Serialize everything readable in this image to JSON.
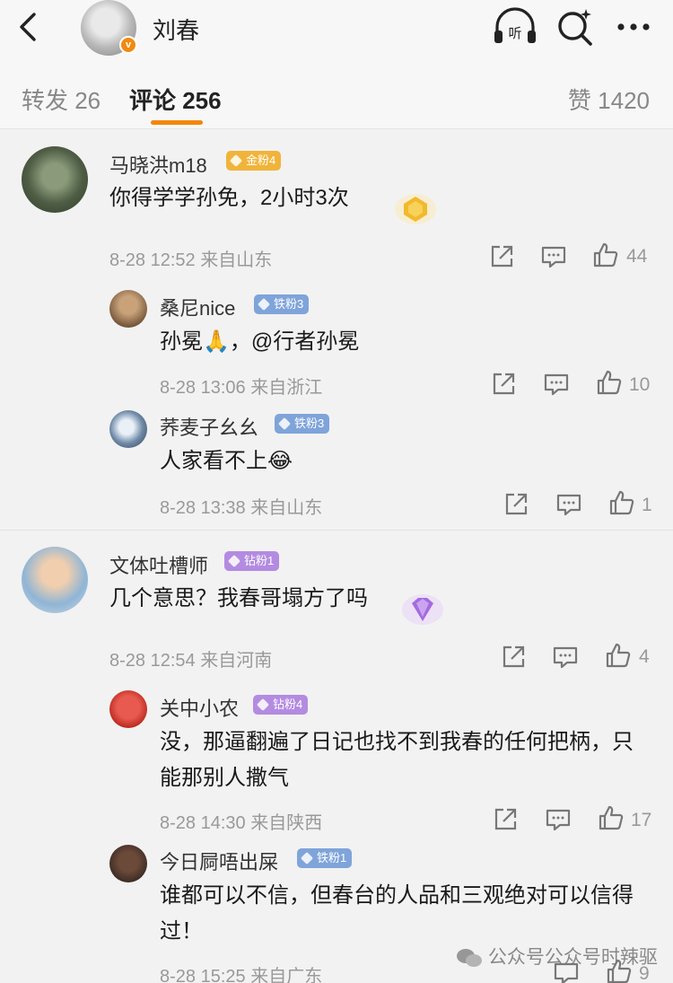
{
  "header": {
    "title": "刘春",
    "verified_mark": "v"
  },
  "tabs": [
    {
      "label": "转发 26"
    },
    {
      "label": "评论 256"
    },
    {
      "label": "赞 1420"
    }
  ],
  "comments": [
    {
      "user": "马晓洪m18",
      "badge": "金粉4",
      "text": "你得学学孙免，2小时3次",
      "meta": "8-28 12:52  来自山东",
      "likes": "44",
      "replies": [
        {
          "user": "桑尼nice",
          "badge": "铁粉3",
          "text": "孙冕🙏，@行者孙冕",
          "meta": "8-28 13:06  来自浙江",
          "likes": "10"
        },
        {
          "user": "荞麦子幺幺",
          "badge": "铁粉3",
          "text": "人家看不上😂",
          "meta": "8-28 13:38  来自山东",
          "likes": "1"
        }
      ]
    },
    {
      "user": "文体吐槽师",
      "badge": "钻粉1",
      "text": "几个意思？我春哥塌方了吗",
      "meta": "8-28 12:54  来自河南",
      "likes": "4",
      "replies": [
        {
          "user": "关中小农",
          "badge": "钻粉4",
          "text": "没，那逼翻遍了日记也找不到我春的任何把柄，只能那别人撒气",
          "meta": "8-28 14:30  来自陕西",
          "likes": "17"
        },
        {
          "user": "今日屙唔出屎",
          "badge": "铁粉1",
          "text": "谁都可以不信，但春台的人品和三观绝对可以信得过！",
          "meta": "8-28 15:25  来自广东",
          "likes": "9"
        }
      ]
    }
  ],
  "watermark": "公众号公众号时辣驱",
  "colors": {
    "accent": "#f3870b",
    "gold_badge": "#f0b43a",
    "iron_badge": "#7fa4d9",
    "diamond_badge": "#b38be0"
  },
  "icons": [
    "back-arrow-icon",
    "listen-icon",
    "search-icon",
    "more-icon",
    "share-icon",
    "comment-icon",
    "like-icon"
  ]
}
